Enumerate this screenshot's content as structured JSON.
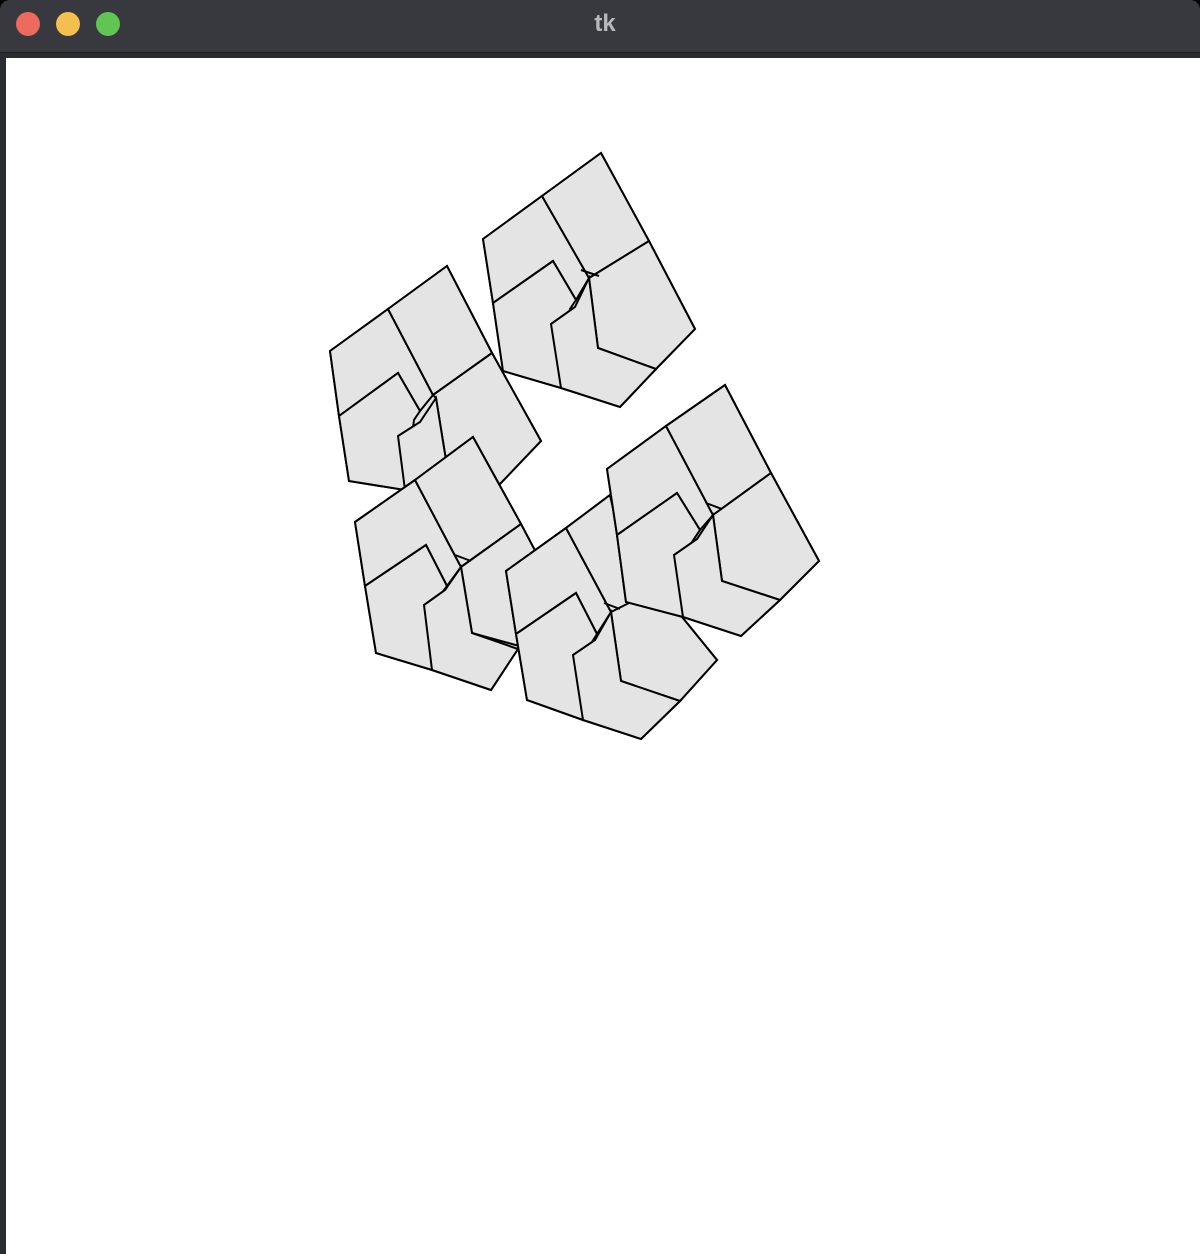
{
  "window": {
    "title": "tk",
    "controls": {
      "close": "close-button",
      "minimize": "minimize-button",
      "zoom": "zoom-button"
    }
  },
  "canvas": {
    "background": "#ffffff",
    "shape_fill": "#e4e4e4",
    "stroke": "#000000"
  }
}
